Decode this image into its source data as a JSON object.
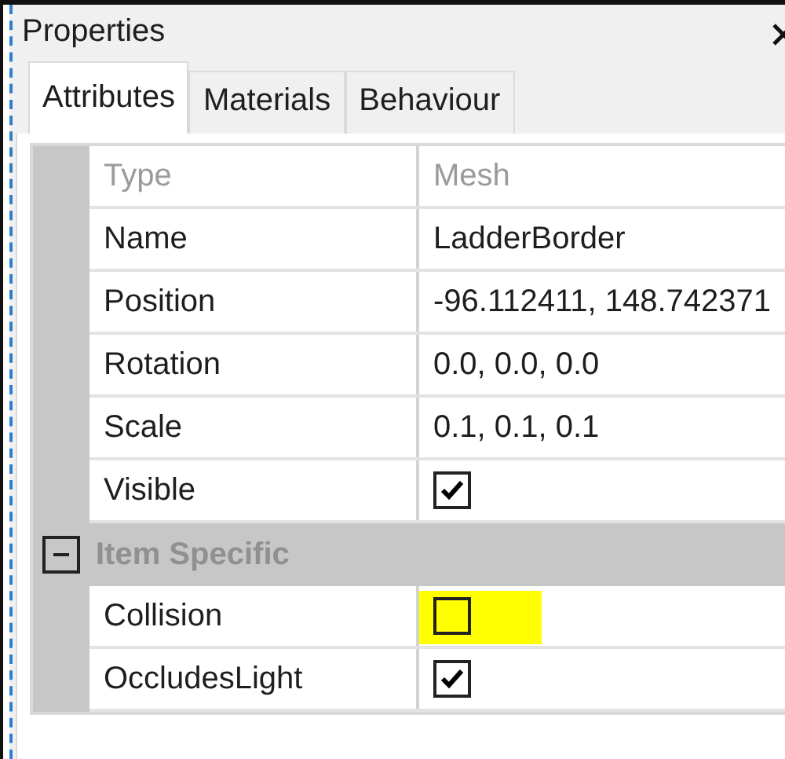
{
  "panel": {
    "title": "Properties"
  },
  "tabs": [
    {
      "label": "Attributes",
      "selected": true
    },
    {
      "label": "Materials",
      "selected": false
    },
    {
      "label": "Behaviour",
      "selected": false
    }
  ],
  "properties": [
    {
      "name": "Type",
      "kind": "text",
      "value": "Mesh",
      "disabled": true
    },
    {
      "name": "Name",
      "kind": "text",
      "value": "LadderBorder",
      "disabled": false
    },
    {
      "name": "Position",
      "kind": "text",
      "value": "-96.112411, 148.742371",
      "disabled": false
    },
    {
      "name": "Rotation",
      "kind": "text",
      "value": "0.0, 0.0, 0.0",
      "disabled": false
    },
    {
      "name": "Scale",
      "kind": "text",
      "value": "0.1, 0.1, 0.1",
      "disabled": false
    },
    {
      "name": "Visible",
      "kind": "checkbox",
      "checked": true,
      "highlighted": false
    }
  ],
  "groups": [
    {
      "title": "Item Specific",
      "expanded": true,
      "properties": [
        {
          "name": "Collision",
          "kind": "checkbox",
          "checked": false,
          "highlighted": true
        },
        {
          "name": "OccludesLight",
          "kind": "checkbox",
          "checked": true,
          "highlighted": false
        }
      ]
    }
  ]
}
